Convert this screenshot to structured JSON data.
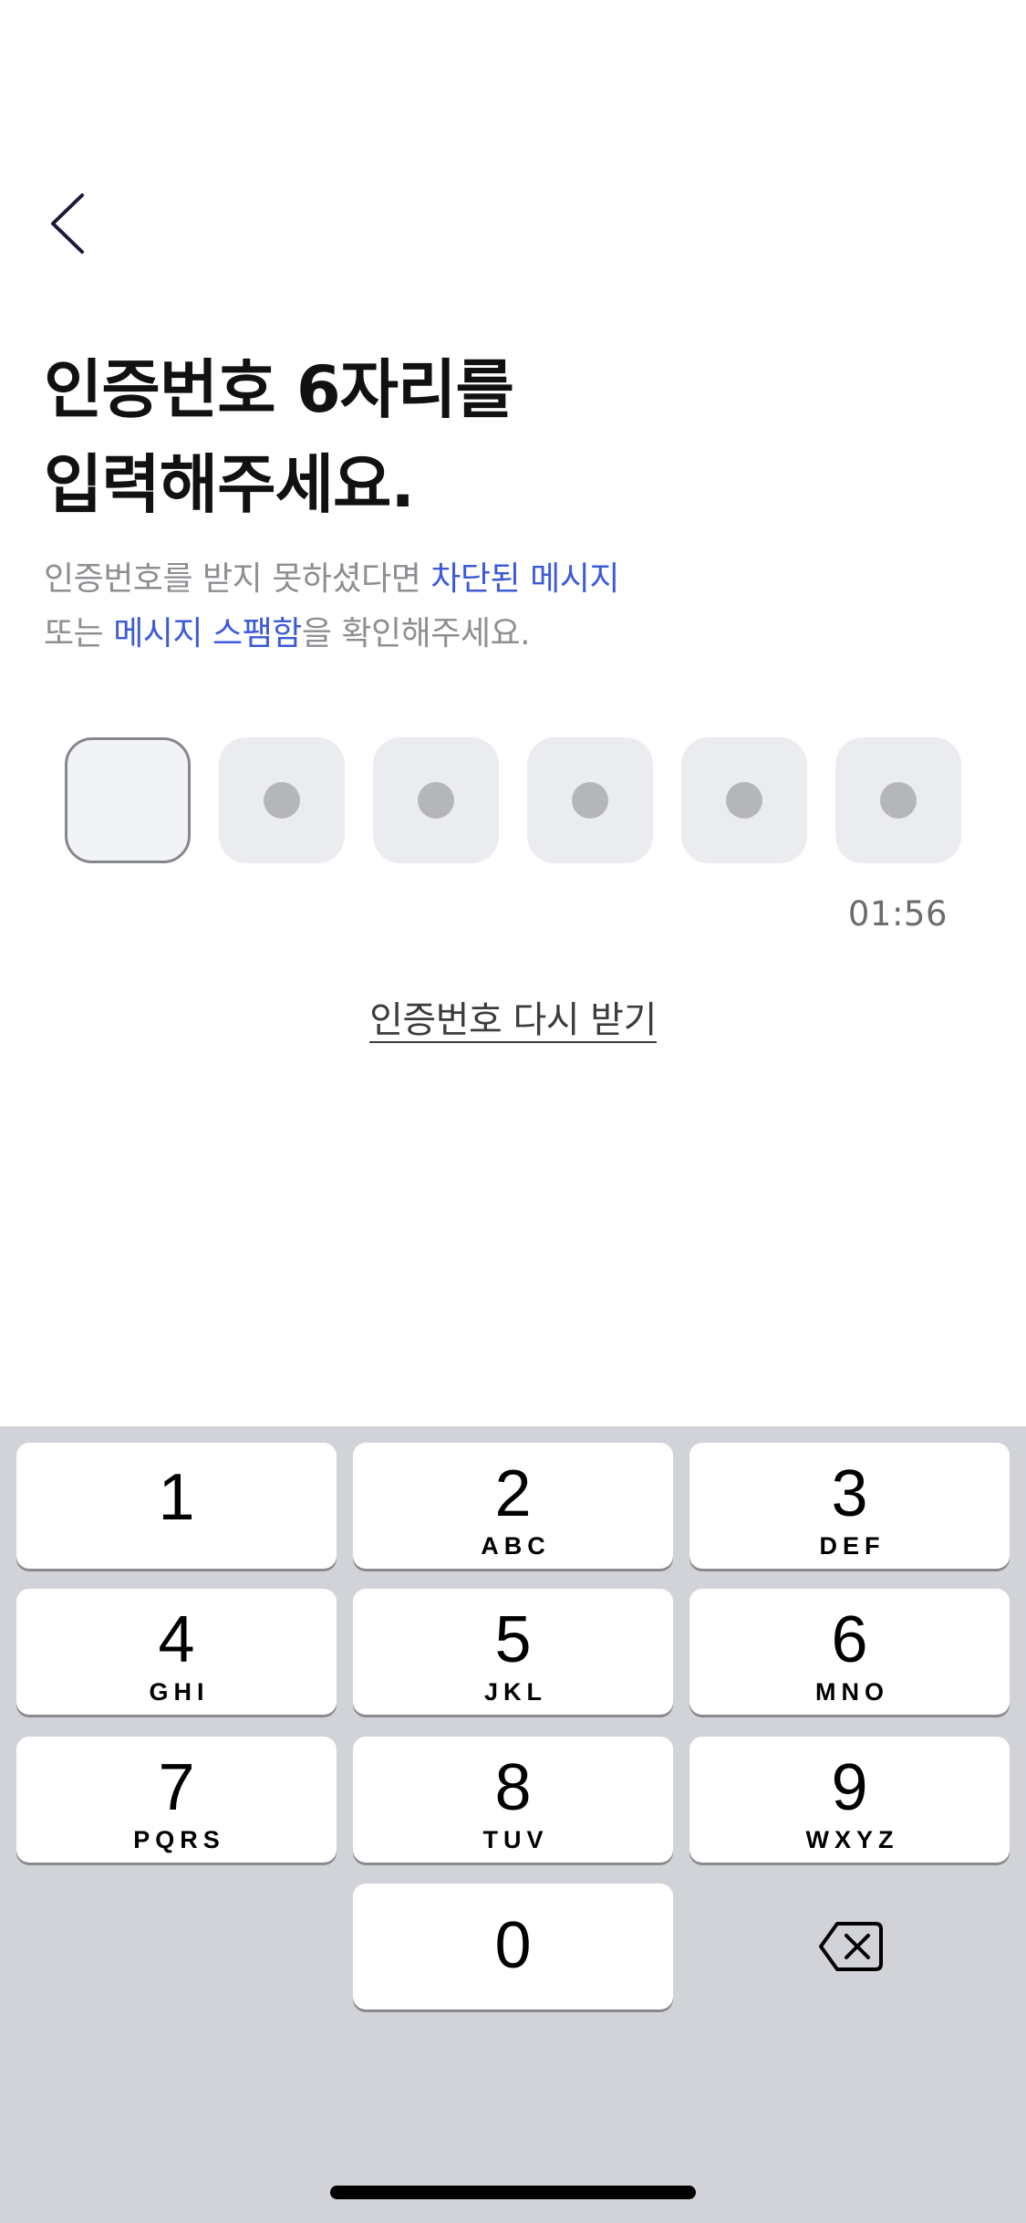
{
  "header": {
    "back_icon": "chevron-left-icon"
  },
  "title": {
    "line1": "인증번호 6자리를",
    "line2": "입력해주세요."
  },
  "subtitle": {
    "line1_prefix": "인증번호를 받지 못하셨다면 ",
    "line1_link": "차단된 메시지",
    "line2_prefix": "또는 ",
    "line2_link": "메시지 스팸함",
    "line2_suffix": "을 확인해주세요."
  },
  "code_input": {
    "length": 6,
    "filled": 0
  },
  "timer": "01:56",
  "resend_label": "인증번호 다시 받기",
  "keypad": {
    "keys": [
      {
        "digit": "1",
        "letters": ""
      },
      {
        "digit": "2",
        "letters": "ABC"
      },
      {
        "digit": "3",
        "letters": "DEF"
      },
      {
        "digit": "4",
        "letters": "GHI"
      },
      {
        "digit": "5",
        "letters": "JKL"
      },
      {
        "digit": "6",
        "letters": "MNO"
      },
      {
        "digit": "7",
        "letters": "PQRS"
      },
      {
        "digit": "8",
        "letters": "TUV"
      },
      {
        "digit": "9",
        "letters": "WXYZ"
      },
      {
        "digit": "0",
        "letters": ""
      }
    ],
    "backspace_icon": "backspace-icon"
  },
  "colors": {
    "link": "#3d5bd6",
    "keyboard_bg": "#d1d3d9",
    "code_box_bg": "#ebecf0"
  }
}
